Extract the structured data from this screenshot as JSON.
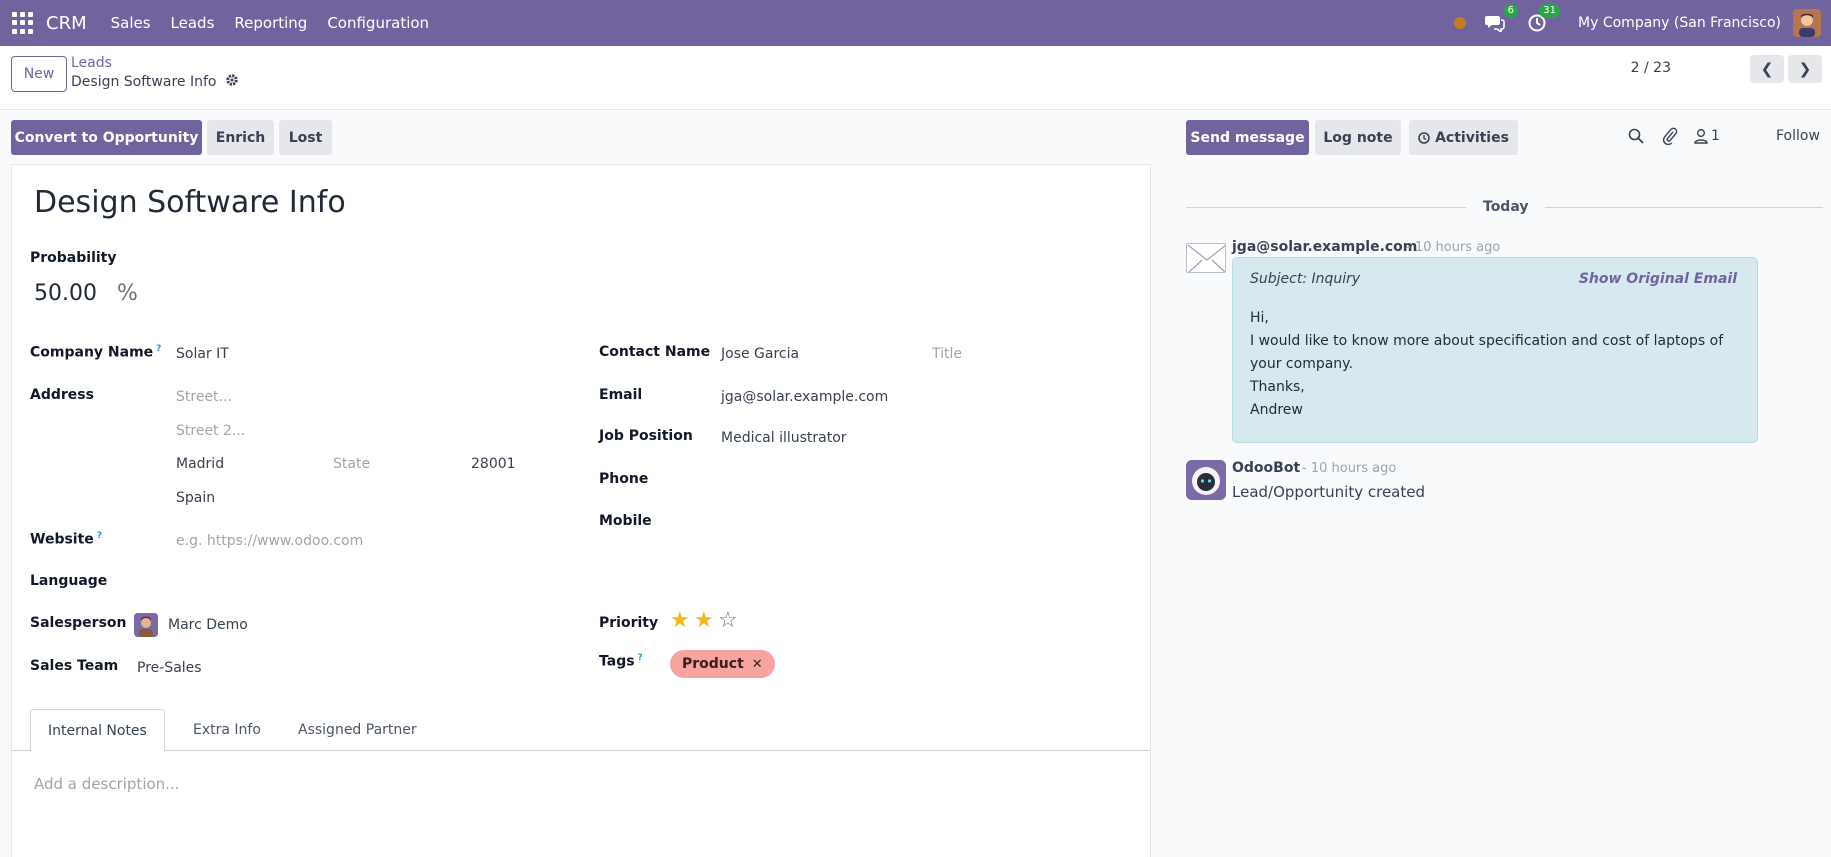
{
  "navbar": {
    "brand": "CRM",
    "menus": [
      "Sales",
      "Leads",
      "Reporting",
      "Configuration"
    ],
    "messages_badge": "6",
    "activities_badge": "31",
    "company": "My Company (San Francisco)",
    "color": "#71639e"
  },
  "control": {
    "new_label": "New",
    "breadcrumb_parent": "Leads",
    "breadcrumb_current": "Design Software Info",
    "pager": "2 / 23"
  },
  "actions": {
    "convert": "Convert to Opportunity",
    "enrich": "Enrich",
    "lost": "Lost"
  },
  "form": {
    "title": "Design Software Info",
    "probability_label": "Probability",
    "probability_value": "50.00",
    "probability_unit": "%",
    "company_name_label": "Company Name",
    "company_name": "Solar IT",
    "address_label": "Address",
    "street_placeholder": "Street...",
    "street2_placeholder": "Street 2...",
    "city": "Madrid",
    "state_placeholder": "State",
    "zip": "28001",
    "country": "Spain",
    "website_label": "Website",
    "website_placeholder": "e.g. https://www.odoo.com",
    "language_label": "Language",
    "salesperson_label": "Salesperson",
    "salesperson": "Marc Demo",
    "sales_team_label": "Sales Team",
    "sales_team": "Pre-Sales",
    "contact_name_label": "Contact Name",
    "contact_name": "Jose Garcia",
    "title_placeholder": "Title",
    "email_label": "Email",
    "email": "jga@solar.example.com",
    "job_position_label": "Job Position",
    "job_position": "Medical illustrator",
    "phone_label": "Phone",
    "mobile_label": "Mobile",
    "priority_label": "Priority",
    "priority_value": 2,
    "priority_max": 3,
    "tags_label": "Tags",
    "tag": "Product",
    "help_mark": "?"
  },
  "tabs": [
    "Internal Notes",
    "Extra Info",
    "Assigned Partner"
  ],
  "description_placeholder": "Add a description...",
  "chatter": {
    "send_message": "Send message",
    "log_note": "Log note",
    "activities": "Activities",
    "followers_count": "1",
    "follow": "Follow",
    "today": "Today",
    "messages": [
      {
        "author": "jga@solar.example.com",
        "time": "- 10 hours ago",
        "subject": "Subject: Inquiry",
        "show_original": "Show Original Email",
        "body": [
          "Hi,",
          "I would like to know more about specification and cost of laptops of your company.",
          "Thanks,",
          "Andrew"
        ]
      },
      {
        "author": "OdooBot",
        "time": "- 10 hours ago",
        "body": "Lead/Opportunity created"
      }
    ]
  }
}
